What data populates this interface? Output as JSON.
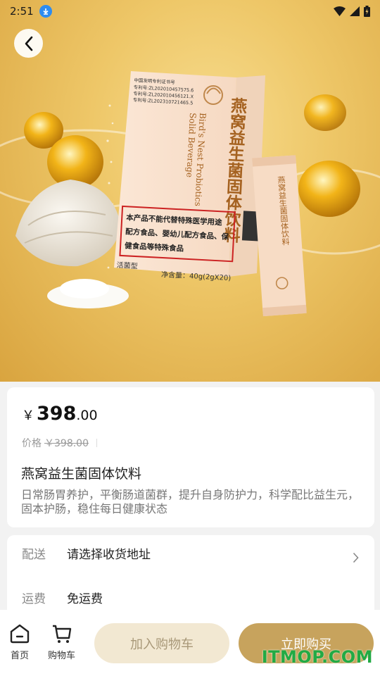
{
  "status_bar": {
    "time": "2:51"
  },
  "product_image": {
    "box_title_cn": "燕窝益生菌固体饮料",
    "box_title_en_line1": "Bird's Nest Probiotics",
    "box_title_en_line2": "Solid Beverage",
    "box_warning_line1": "本产品不能代替特殊医学用途",
    "box_warning_line2": "配方食品、婴幼儿配方食品、保",
    "box_warning_line3": "健食品等特殊食品",
    "box_type": "活菌型",
    "box_net": "净含量：40g(2gX20)",
    "box_patent_head": "中国发明专利证书号",
    "box_patent_1": "专利号:ZL202010457575.6",
    "box_patent_2": "专利号:ZL202010456121.X",
    "box_patent_3": "专利号:ZL202310721465.5",
    "sachet_text": "燕窝益生菌固体饮料"
  },
  "price": {
    "currency": "￥",
    "integer": "398",
    "decimal": ".00",
    "original_label": "价格",
    "original_value": "￥398.00"
  },
  "product": {
    "title": "燕窝益生菌固体饮料",
    "description": "日常肠胃养护，平衡肠道菌群，提升自身防护力，科学配比益生元，固本护肠，稳住每日健康状态"
  },
  "shipping": {
    "delivery_label": "配送",
    "delivery_value": "请选择收货地址",
    "fee_label": "运费",
    "fee_value": "免运费"
  },
  "bottom_bar": {
    "home_label": "首页",
    "cart_label": "购物车",
    "add_cart_label": "加入购物车",
    "buy_now_label": "立即购买"
  },
  "watermark": "ITMOP.COM",
  "colors": {
    "accent": "#c7a35d",
    "accent_light": "#f2e8d2",
    "watermark": "#22aa44"
  }
}
